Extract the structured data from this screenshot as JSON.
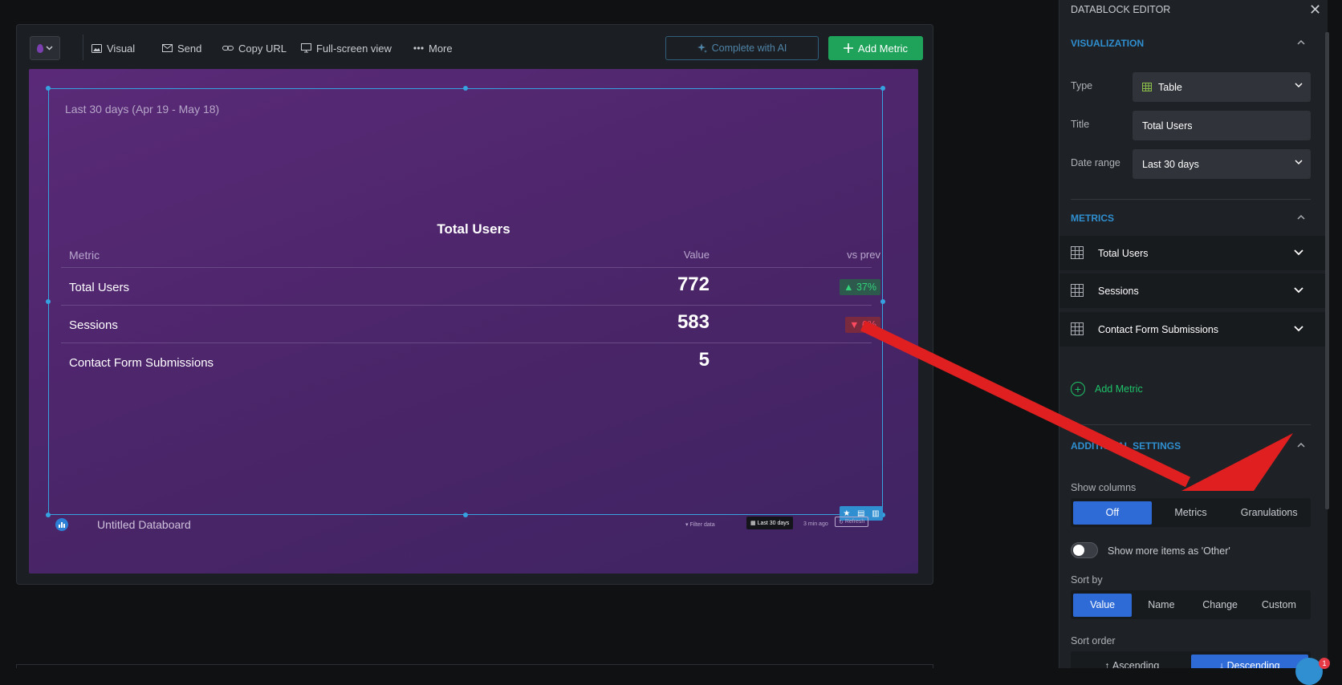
{
  "toolbar": {
    "items": [
      {
        "label": "Visual",
        "icon": "image-icon"
      },
      {
        "label": "Send",
        "icon": "mail-icon"
      },
      {
        "label": "Copy URL",
        "icon": "link-icon"
      },
      {
        "label": "Full-screen view",
        "icon": "monitor-icon"
      },
      {
        "label": "More",
        "icon": "dots-icon"
      }
    ],
    "ai_label": "Complete with AI",
    "add_metric_label": "Add Metric"
  },
  "datablock": {
    "range_label": "Last 30 days (Apr 19 - May 18)",
    "title": "Total Users",
    "columns": {
      "metric": "Metric",
      "value": "Value",
      "vs_prev": "vs prev"
    },
    "rows": [
      {
        "metric": "Total Users",
        "value": "772",
        "change": "▲ 37%",
        "direction": "up"
      },
      {
        "metric": "Sessions",
        "value": "583",
        "change": "▼ 6%",
        "direction": "down"
      },
      {
        "metric": "Contact Form Submissions",
        "value": "5",
        "change": "",
        "direction": "none"
      }
    ]
  },
  "footer": {
    "name": "Untitled Databoard",
    "filter": "Filter data",
    "date": "Last 30 days",
    "updated": "3 min ago",
    "refresh": "Refresh"
  },
  "panel": {
    "title": "DATABLOCK EDITOR",
    "visualization": {
      "section_title": "VISUALIZATION",
      "type_label": "Type",
      "type_value": "Table",
      "title_label": "Title",
      "title_value": "Total Users",
      "date_label": "Date range",
      "date_value": "Last 30 days"
    },
    "metrics": {
      "section_title": "METRICS",
      "items": [
        "Total Users",
        "Sessions",
        "Contact Form Submissions"
      ],
      "add_label": "Add Metric"
    },
    "additional": {
      "section_title": "ADDITIONAL SETTINGS",
      "show_columns_label": "Show columns",
      "show_columns_options": [
        "Off",
        "Metrics",
        "Granulations"
      ],
      "show_columns_selected": "Off",
      "other_toggle_label": "Show more items as 'Other'",
      "other_toggle_on": false,
      "sort_by_label": "Sort by",
      "sort_by_options": [
        "Value",
        "Name",
        "Change",
        "Custom"
      ],
      "sort_by_selected": "Value",
      "sort_order_label": "Sort order",
      "sort_order_options": [
        "Ascending",
        "Descending"
      ],
      "sort_order_selected": "Descending"
    }
  },
  "chat": {
    "badge": "1"
  },
  "colors": {
    "accent_blue": "#2f8fd0",
    "green": "#1fa25a",
    "annotation_red": "#e02020",
    "canvas_purple": "#4a2568"
  }
}
